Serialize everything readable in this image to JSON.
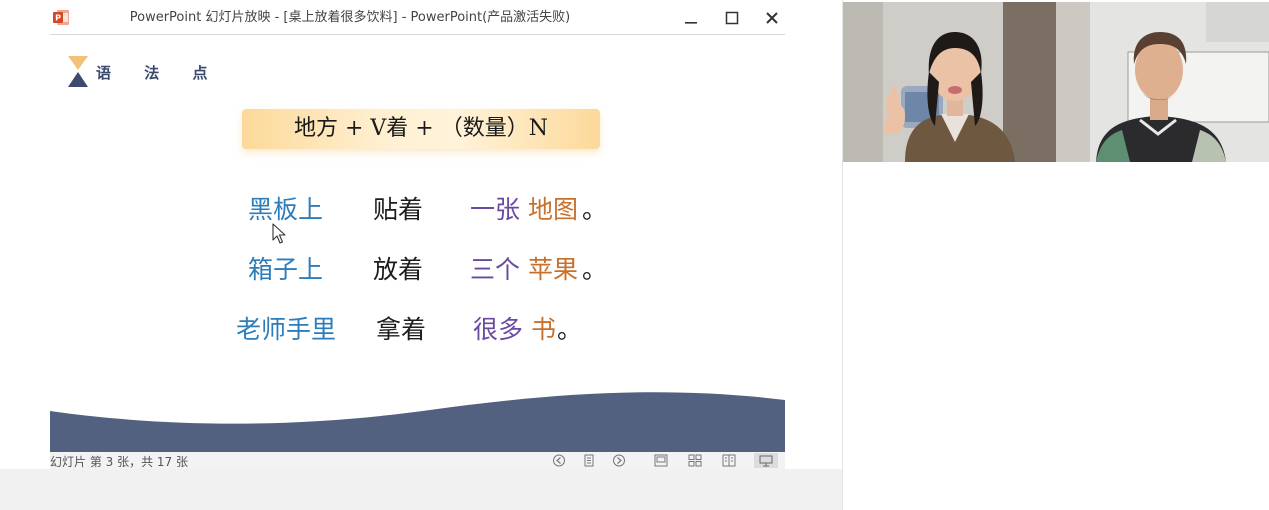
{
  "window": {
    "title": "PowerPoint 幻灯片放映 - [桌上放着很多饮料] - PowerPoint(产品激活失败)",
    "app_icon": "powerpoint-icon",
    "minimize_icon": "minimize-icon",
    "maximize_icon": "maximize-icon",
    "close_icon": "close-icon"
  },
  "slide": {
    "section_title": "语 法 点",
    "formula": "地方 + V着 + （数量）N",
    "sentences": [
      {
        "place": "黑板上",
        "verb": "贴着",
        "measure": "一张",
        "noun": "地图",
        "end": "。"
      },
      {
        "place": "箱子上",
        "verb": "放着",
        "measure": "三个",
        "noun": "苹果",
        "end": "。"
      },
      {
        "place": "老师手里",
        "verb": "拿着",
        "measure": "很多",
        "noun": "书",
        "end": "。"
      }
    ]
  },
  "statusbar": {
    "slide_counter": "幻灯片 第 3 张，共 17 张",
    "icons": [
      "previous-slide-icon",
      "slide-menu-icon",
      "next-slide-icon",
      "normal-view-icon",
      "slide-sorter-icon",
      "reading-view-icon",
      "slideshow-view-icon"
    ]
  },
  "colors": {
    "place": "#2e7dbb",
    "verb": "#1c1c1c",
    "measure": "#6a4aa1",
    "noun": "#c8712c",
    "wave": "#52617f",
    "section_title": "#3c4a6e",
    "formula_bg": "#fcd99a"
  },
  "video": {
    "participants": [
      "teacher-video",
      "student-video"
    ]
  }
}
